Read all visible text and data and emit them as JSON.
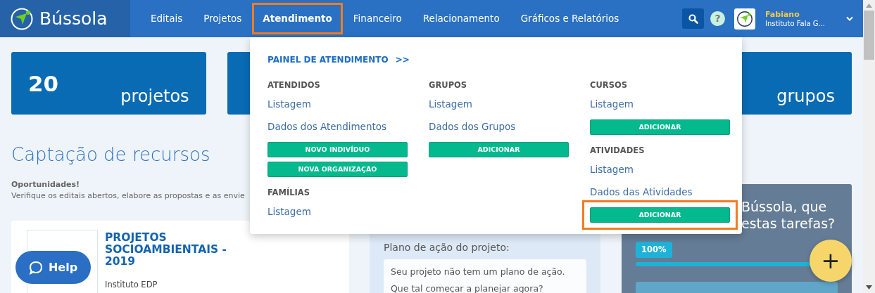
{
  "brand": {
    "name": "Bússola"
  },
  "nav": [
    {
      "label": "Editais",
      "selected": false,
      "highlighted": false
    },
    {
      "label": "Projetos",
      "selected": false,
      "highlighted": false
    },
    {
      "label": "Atendimento",
      "selected": true,
      "highlighted": true
    },
    {
      "label": "Financeiro",
      "selected": false,
      "highlighted": false
    },
    {
      "label": "Relacionamento",
      "selected": false,
      "highlighted": false
    },
    {
      "label": "Gráficos e Relatórios",
      "selected": false,
      "highlighted": false
    }
  ],
  "header": {
    "help": "?",
    "user": {
      "name": "Fabiano",
      "org": "Instituto Fala G..."
    }
  },
  "stats": [
    {
      "kind": "stat",
      "value": "20",
      "label": "projetos"
    },
    {
      "kind": "covered"
    },
    {
      "kind": "stat",
      "label": "grupos"
    }
  ],
  "section": {
    "title": "Captação de recursos",
    "subtitle": "Oportunidades!",
    "text": "Verifique os editais abertos, elabore as propostas e as envie"
  },
  "opportunity": {
    "title": "PROJETOS SOCIOAMBIENTAIS - 2019",
    "org": "Instituto EDP"
  },
  "plan": {
    "title": "Plano de ação do projeto:",
    "text": "Seu projeto não tem um plano de ação. Que tal começar a planejar agora?"
  },
  "tasks": {
    "lines": [
      "Bússola, que",
      "estas tarefas?"
    ],
    "badge": "100%",
    "level": 1
  },
  "dropdown": {
    "panel_link": "PAINEL DE ATENDIMENTO",
    "panel_arrow": ">>",
    "columns": [
      [
        {
          "title": "ATENDIDOS",
          "links": [
            "Listagem",
            "Dados dos Atendimentos"
          ],
          "buttons": [
            {
              "label": "NOVO INDIVÍDUO",
              "highlighted": false
            },
            {
              "label": "NOVA ORGANIZAÇÃO",
              "highlighted": false
            }
          ]
        },
        {
          "title": "FAMÍLIAS",
          "links": [
            "Listagem"
          ]
        }
      ],
      [
        {
          "title": "GRUPOS",
          "links": [
            "Listagem",
            "Dados dos Grupos"
          ],
          "buttons": [
            {
              "label": "ADICIONAR",
              "highlighted": false
            }
          ]
        }
      ],
      [
        {
          "title": "CURSOS",
          "links": [
            "Listagem"
          ],
          "buttons": [
            {
              "label": "ADICIONAR",
              "highlighted": false
            }
          ]
        },
        {
          "title": "ATIVIDADES",
          "links": [
            "Listagem",
            "Dados das Atividades"
          ],
          "buttons": [
            {
              "label": "ADICIONAR",
              "highlighted": true
            }
          ]
        }
      ]
    ]
  },
  "help_button": {
    "label": "Help"
  },
  "fab": {
    "label": "+"
  }
}
